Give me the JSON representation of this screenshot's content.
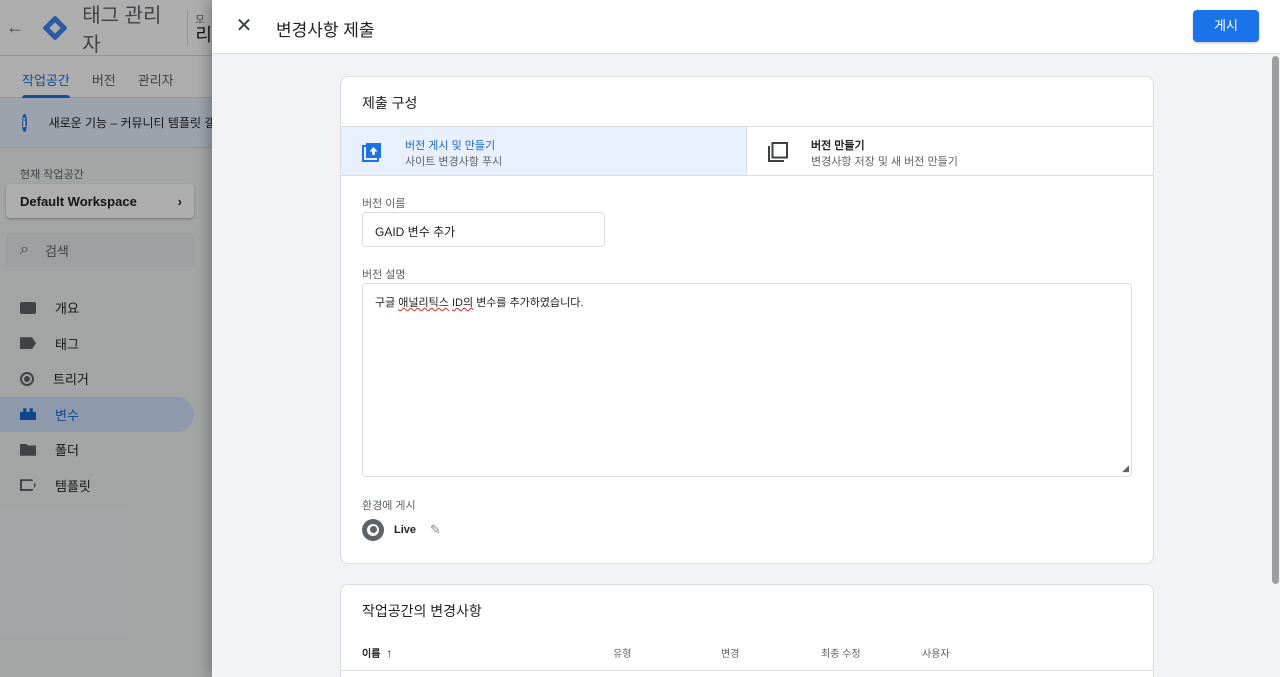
{
  "background": {
    "app_title": "태그 관리자",
    "account_label": "모",
    "account_name": "리",
    "tabs": [
      {
        "label": "작업공간",
        "active": true
      },
      {
        "label": "버전",
        "active": false
      },
      {
        "label": "관리자",
        "active": false
      }
    ],
    "banner_text": "새로운 기능 – 커뮤니티 템플릿 갤",
    "workspace_label": "현재 작업공간",
    "workspace_name": "Default Workspace",
    "search_placeholder": "검색",
    "nav_items": [
      {
        "label": "개요",
        "icon": "overview-icon",
        "active": false
      },
      {
        "label": "태그",
        "icon": "tag-icon",
        "active": false
      },
      {
        "label": "트리거",
        "icon": "trigger-icon",
        "active": false
      },
      {
        "label": "변수",
        "icon": "variable-icon",
        "active": true
      },
      {
        "label": "폴더",
        "icon": "folder-icon",
        "active": false
      },
      {
        "label": "템플릿",
        "icon": "template-icon",
        "active": false
      }
    ]
  },
  "dialog": {
    "title": "변경사항 제출",
    "publish_label": "게시",
    "config_card": {
      "title": "제출 구성",
      "options": [
        {
          "title": "버전 게시 및 만들기",
          "subtitle": "사이트 변경사항 푸시",
          "selected": true
        },
        {
          "title": "버전 만들기",
          "subtitle": "변경사항 저장 및 새 버전 만들기",
          "selected": false
        }
      ],
      "version_name_label": "버전 이름",
      "version_name_value": "GAID 변수 추가",
      "version_desc_label": "버전 설명",
      "version_desc_prefix": "구글 ",
      "version_desc_misspelled_1": "애널리틱스",
      "version_desc_space": " ",
      "version_desc_misspelled_2": "ID의",
      "version_desc_suffix": " 변수를 추가하였습니다.",
      "env_label": "환경에 게시",
      "env_name": "Live"
    },
    "changes_card": {
      "title": "작업공간의 변경사항",
      "columns": [
        "이름",
        "유형",
        "변경",
        "최종 수정",
        "사용자"
      ]
    }
  },
  "colors": {
    "accent": "#1a73e8",
    "selected_bg": "#e8f0fe",
    "nav_active_bg": "#d2e3fc"
  }
}
